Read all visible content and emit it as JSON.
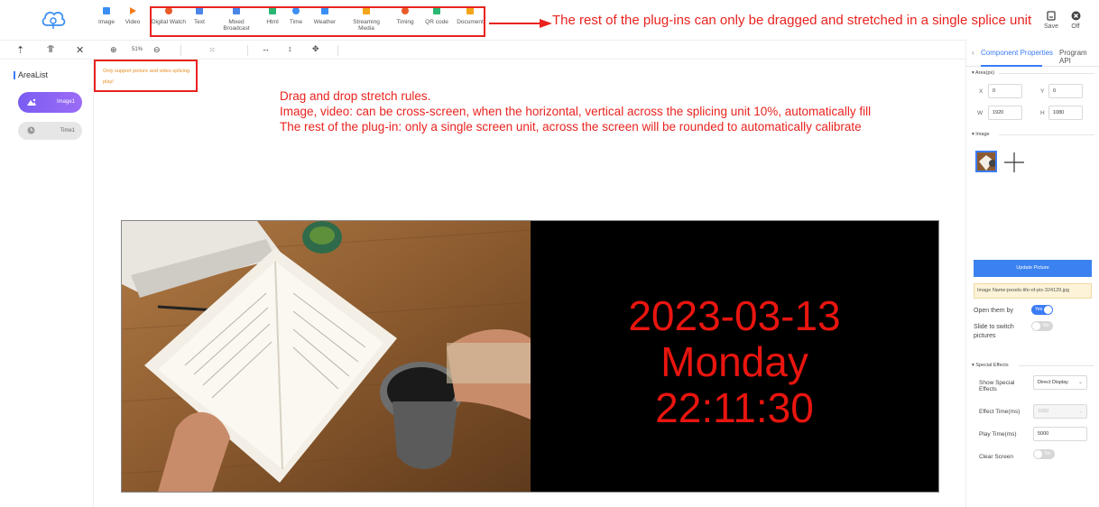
{
  "toolbar": {
    "items": [
      {
        "label": "Image",
        "icon": "image-icon",
        "color": "#3b8ff2"
      },
      {
        "label": "Video",
        "icon": "video-icon",
        "color": "#f07c1d"
      },
      {
        "label": "Digital Watch",
        "icon": "digital-watch-icon",
        "color": "#ea5a2a"
      },
      {
        "label": "Text",
        "icon": "text-icon",
        "color": "#4a86e8"
      },
      {
        "label": "Mixed Broadcast",
        "icon": "mixed-broadcast-icon",
        "color": "#4a86e8"
      },
      {
        "label": "Html",
        "icon": "html-icon",
        "color": "#2bb673"
      },
      {
        "label": "Time",
        "icon": "time-icon",
        "color": "#3b8ff2"
      },
      {
        "label": "Weather",
        "icon": "weather-icon",
        "color": "#3b8ff2"
      },
      {
        "label": "Streaming Media",
        "icon": "streaming-media-icon",
        "color": "#f2a51a"
      },
      {
        "label": "Timing",
        "icon": "timing-icon",
        "color": "#ea5a2a"
      },
      {
        "label": "QR code",
        "icon": "qr-code-icon",
        "color": "#2bb673"
      },
      {
        "label": "Document",
        "icon": "document-icon",
        "color": "#f2a51a"
      }
    ],
    "save_label": "Save",
    "off_label": "Off"
  },
  "annotation_top": "The rest of the plug-ins can only be dragged and stretched in a single splice unit",
  "subtoolbar": {
    "zoom_value": "51%"
  },
  "left_panel": {
    "title": "AreaList",
    "areas": [
      {
        "label": "Image1",
        "active": true
      },
      {
        "label": "Time1",
        "active": false
      }
    ]
  },
  "warning": "Only support picture and video splicing play!",
  "rules": {
    "line1": "Drag and drop stretch rules.",
    "line2": "Image, video: can be cross-screen, when the horizontal, vertical across the splicing unit 10%, automatically fill",
    "line3": "The rest of the plug-in: only a single screen unit, across the screen will be rounded to automatically calibrate"
  },
  "canvas": {
    "date": "2023-03-13",
    "weekday": "Monday",
    "time": "22:11:30",
    "clock_color": "#e8150f"
  },
  "right_panel": {
    "tabs": [
      "Component Properties",
      "Program API"
    ],
    "area_section": "Area(px)",
    "x_label": "X",
    "x_value": "0",
    "y_label": "Y",
    "y_value": "0",
    "w_label": "W",
    "w_value": "1920",
    "h_label": "H",
    "h_value": "1080",
    "image_section": "Image",
    "update_button": "Update Picture",
    "image_name": "Image Name:pexels-life-of-pix-324129.jpg",
    "open_them_by_label": "Open them by",
    "open_them_by_value": "Yes",
    "slide_label": "Slide to switch pictures",
    "slide_value": "No",
    "special_effects_section": "Special Effects",
    "show_effects_label": "Show Special Effects",
    "show_effects_value": "Direct Display",
    "effect_time_label": "Effect Time(ms)",
    "effect_time_value": "1000",
    "play_time_label": "Play Time(ms)",
    "play_time_value": "5000",
    "clear_screen_label": "Clear Screen",
    "clear_screen_value": "No"
  }
}
